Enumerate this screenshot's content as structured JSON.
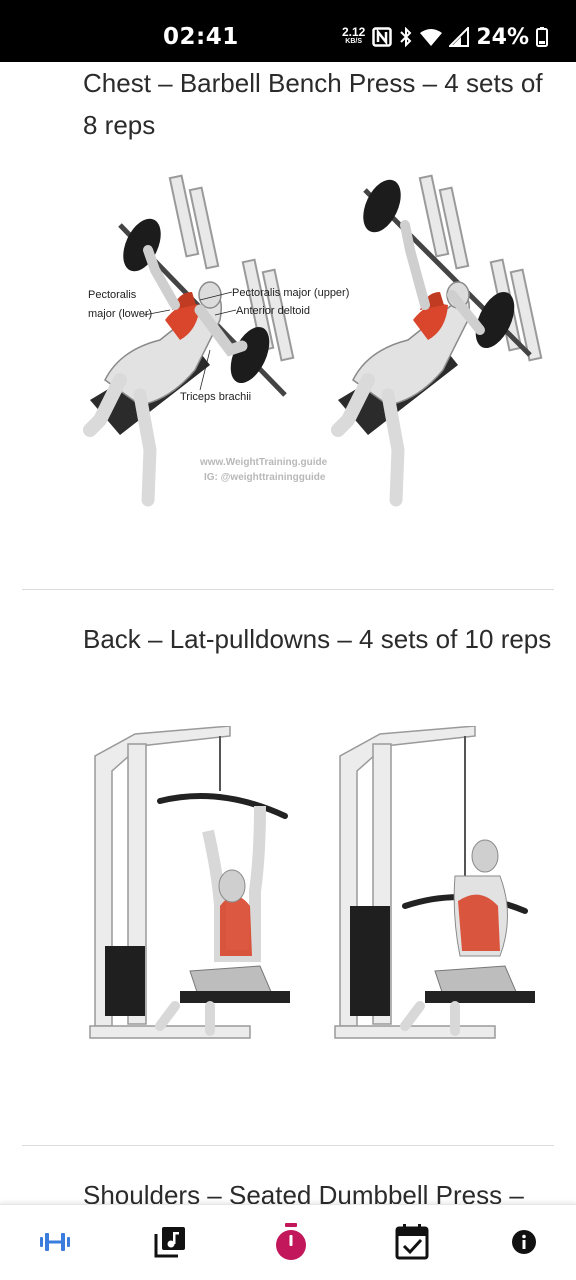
{
  "status_bar": {
    "time": "02:41",
    "net_speed_value": "2.12",
    "net_speed_unit": "KB/S",
    "battery": "24%"
  },
  "exercises": [
    {
      "title": "Chest – Barbell Bench Press – 4 sets of 8 reps"
    },
    {
      "title": "Back – Lat-pulldowns – 4 sets of 10 reps"
    },
    {
      "title": "Shoulders – Seated Dumbbell Press –"
    }
  ],
  "figure_labels": {
    "pectoralis_lower_1": "Pectoralis",
    "pectoralis_lower_2": "major (lower)",
    "pectoralis_upper": "Pectoralis major (upper)",
    "anterior_deltoid": "Anterior deltoid",
    "triceps": "Triceps brachii",
    "watermark_1": "www.WeightTraining.guide",
    "watermark_2": "IG: @weighttrainingguide"
  },
  "bottom_nav": {
    "items": [
      {
        "icon": "dumbbell-icon",
        "active": true
      },
      {
        "icon": "music-library-icon",
        "active": false
      },
      {
        "icon": "stopwatch-icon",
        "active": false
      },
      {
        "icon": "calendar-check-icon",
        "active": false
      },
      {
        "icon": "info-icon",
        "active": false
      }
    ]
  },
  "colors": {
    "accent_blue": "#3b7ddd",
    "accent_pink": "#c2185b",
    "muscle_red": "#d9462b",
    "status_bar_bg": "#000000"
  }
}
